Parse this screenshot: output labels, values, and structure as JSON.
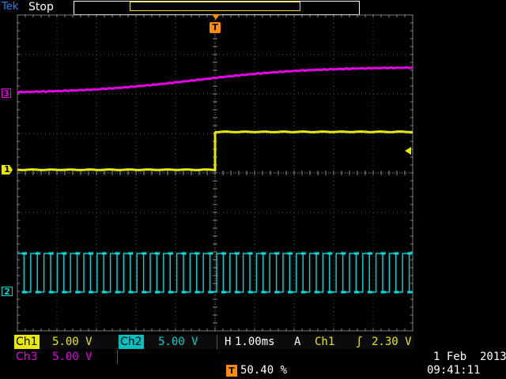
{
  "header": {
    "brand": "Tek",
    "status": "Stop"
  },
  "markers": {
    "ch3": "3",
    "ch1": "1",
    "ch2": "2",
    "trigger": "T"
  },
  "readout": {
    "ch1": {
      "label": "Ch1",
      "scale": "5.00 V"
    },
    "ch2": {
      "label": "Ch2",
      "scale": "5.00 V"
    },
    "ch3": {
      "label": "Ch3",
      "scale": "5.00 V"
    },
    "horizontal": {
      "label": "H",
      "scale": "1.00ms"
    },
    "trigger": {
      "mode": "A",
      "source": "Ch1",
      "slope": "ʃ",
      "level": "2.30 V"
    },
    "position": {
      "marker": "T",
      "value": "50.40 %"
    },
    "date": "1 Feb  2013",
    "time": "09:41:11"
  },
  "colors": {
    "ch1": "#e8e800",
    "ch2": "#00d0d0",
    "ch3": "#e600e6",
    "grid": "#7a7a7a",
    "trigger": "#ff8c00"
  }
}
